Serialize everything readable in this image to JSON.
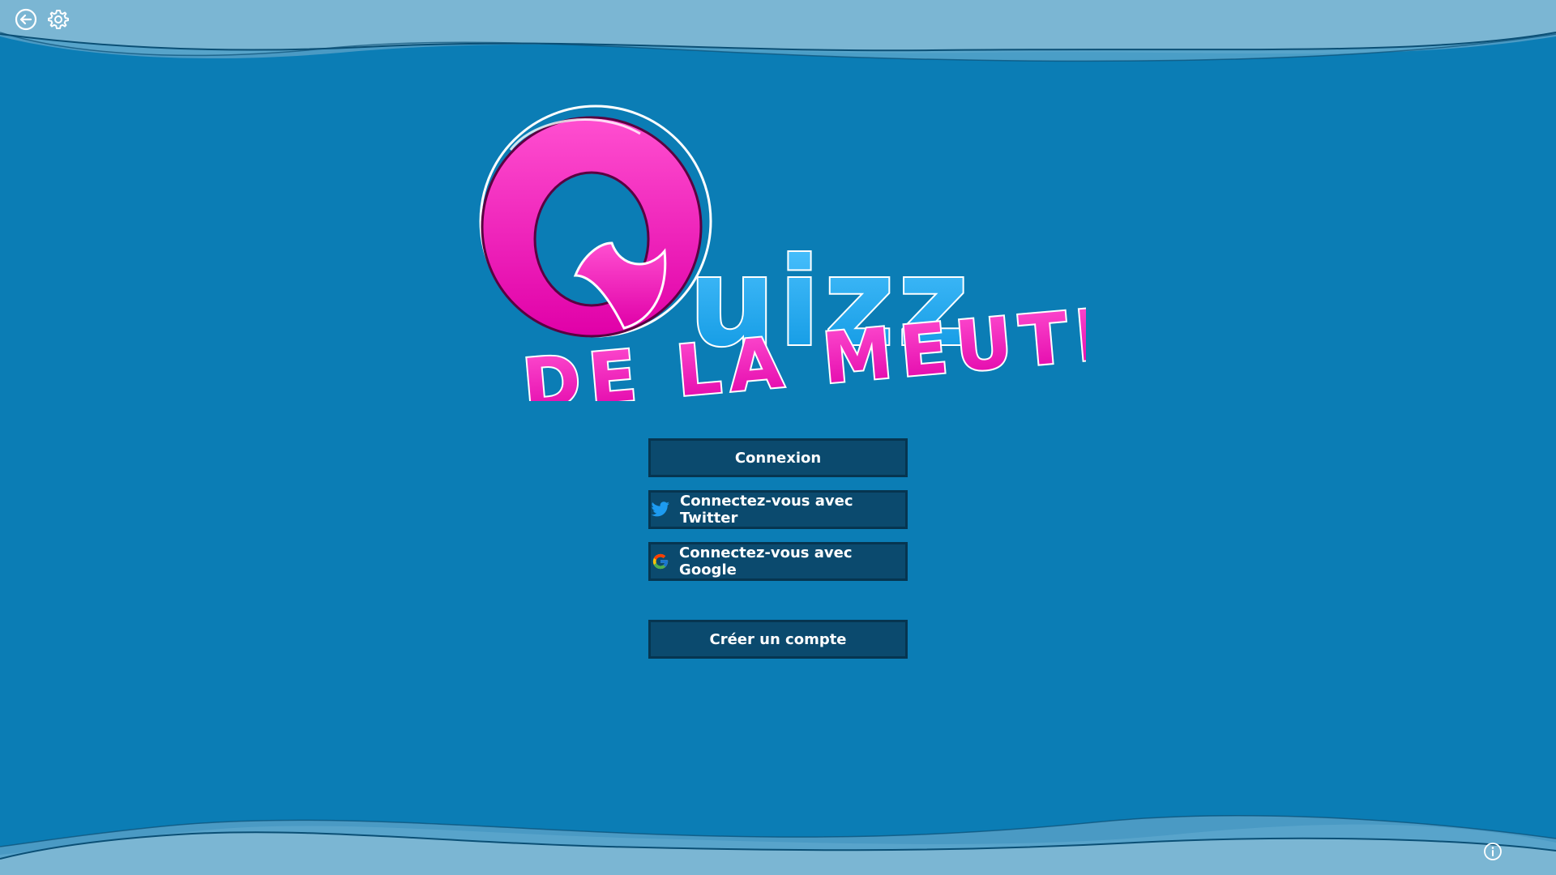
{
  "app": {
    "logo_text_main": "Quizz",
    "logo_text_sub": "de la meute"
  },
  "toolbar": {
    "back_icon": "arrow-left-circle-icon",
    "settings_icon": "gear-icon"
  },
  "buttons": {
    "login_label": "Connexion",
    "twitter_label": "Connectez-vous avec Twitter",
    "google_label": "Connectez-vous avec Google",
    "create_account_label": "Créer un compte"
  },
  "footer": {
    "info_icon": "info-icon"
  },
  "colors": {
    "background": "#0b7db5",
    "wave_light": "#7bb6d3",
    "button_bg": "#0b4a6e",
    "button_border": "#063550",
    "logo_pink": "#f01ab8",
    "logo_blue": "#19a9f0",
    "twitter_blue": "#1d9bf0"
  }
}
